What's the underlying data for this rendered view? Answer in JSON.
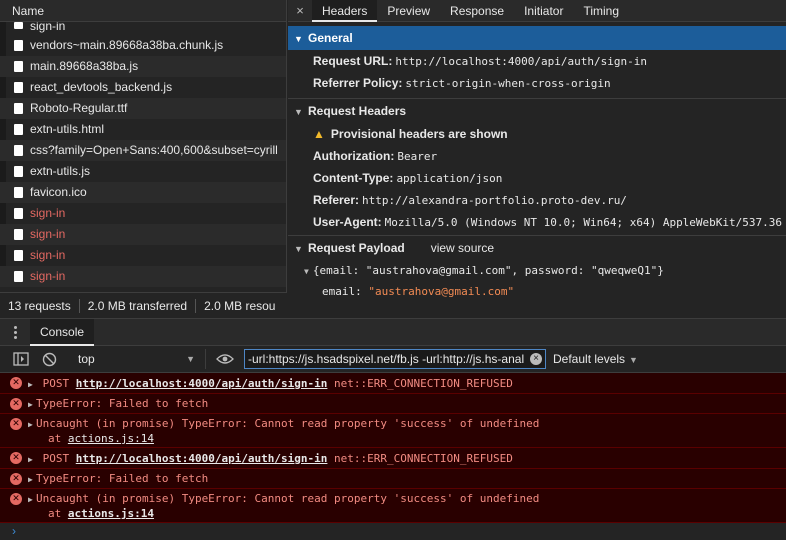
{
  "network": {
    "name_header": "Name",
    "files": [
      {
        "name": "sign-in",
        "error": false,
        "partial": true
      },
      {
        "name": "vendors~main.89668a38ba.chunk.js",
        "error": false
      },
      {
        "name": "main.89668a38ba.js",
        "error": false
      },
      {
        "name": "react_devtools_backend.js",
        "error": false
      },
      {
        "name": "Roboto-Regular.ttf",
        "error": false
      },
      {
        "name": "extn-utils.html",
        "error": false
      },
      {
        "name": "css?family=Open+Sans:400,600&subset=cyrill",
        "error": false
      },
      {
        "name": "extn-utils.js",
        "error": false
      },
      {
        "name": "favicon.ico",
        "error": false
      },
      {
        "name": "sign-in",
        "error": true
      },
      {
        "name": "sign-in",
        "error": true
      },
      {
        "name": "sign-in",
        "error": true
      },
      {
        "name": "sign-in",
        "error": true
      }
    ],
    "status": {
      "requests": "13 requests",
      "transferred": "2.0 MB transferred",
      "resources": "2.0 MB resou"
    }
  },
  "details": {
    "close_glyph": "×",
    "tabs": [
      "Headers",
      "Preview",
      "Response",
      "Initiator",
      "Timing"
    ],
    "active_tab": "Headers",
    "general": {
      "title": "General",
      "request_url_label": "Request URL:",
      "request_url": "http://localhost:4000/api/auth/sign-in",
      "referrer_policy_label": "Referrer Policy:",
      "referrer_policy": "strict-origin-when-cross-origin"
    },
    "request_headers": {
      "title": "Request Headers",
      "provisional": "Provisional headers are shown",
      "authorization_label": "Authorization:",
      "authorization": "Bearer",
      "content_type_label": "Content-Type:",
      "content_type": "application/json",
      "referer_label": "Referer:",
      "referer": "http://alexandra-portfolio.proto-dev.ru/",
      "user_agent_label": "User-Agent:",
      "user_agent": "Mozilla/5.0 (Windows NT 10.0; Win64; x64) AppleWebKit/537.36"
    },
    "payload": {
      "title": "Request Payload",
      "view_source": "view source",
      "summary": "{email: \"austrahova@gmail.com\", password: \"qweqweQ1\"}",
      "email_key": "email:",
      "email_value": "\"austrahova@gmail.com\""
    }
  },
  "console": {
    "tab": "Console",
    "context": "top",
    "filter_value": "-url:https://js.hsadspixel.net/fb.js -url:http://js.hs-anal",
    "levels": "Default levels",
    "messages": [
      {
        "method": "POST",
        "url": "http://localhost:4000/api/auth/sign-in",
        "error": "net::ERR_CONNECTION_REFUSED"
      },
      {
        "text": "TypeError: Failed to fetch"
      },
      {
        "text": "Uncaught (in promise) TypeError: Cannot read property 'success' of undefined",
        "at": "at",
        "source": "actions.js:14"
      },
      {
        "method": "POST",
        "url": "http://localhost:4000/api/auth/sign-in",
        "error": "net::ERR_CONNECTION_REFUSED"
      },
      {
        "text": "TypeError: Failed to fetch"
      },
      {
        "text": "Uncaught (in promise) TypeError: Cannot read property 'success' of undefined",
        "at": "at",
        "source": "actions.js:14"
      }
    ],
    "prompt": "›"
  },
  "colors": {
    "selected_section": "#1c5d9a",
    "error_bg": "#290000",
    "error_text": "#f28b82",
    "error_file": "#e46962",
    "warning": "#f2b92b"
  }
}
